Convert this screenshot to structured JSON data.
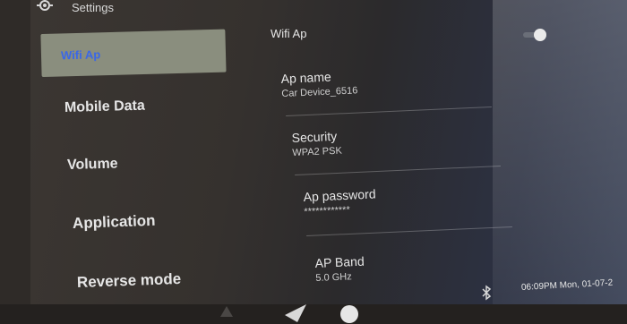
{
  "header": {
    "title": "Settings",
    "icon": "gear-icon"
  },
  "sidebar": {
    "items": [
      {
        "label": "Wifi Ap",
        "active": true
      },
      {
        "label": "Mobile Data"
      },
      {
        "label": "Volume"
      },
      {
        "label": "Application"
      },
      {
        "label": "Reverse mode"
      }
    ]
  },
  "main": {
    "title": "Wifi Ap",
    "toggle_on": true,
    "prefs": [
      {
        "label": "Ap name",
        "value": "Car Device_6516"
      },
      {
        "label": "Security",
        "value": "WPA2 PSK"
      },
      {
        "label": "Ap password",
        "value": "************"
      },
      {
        "label": "AP Band",
        "value": "5.0 GHz"
      }
    ]
  },
  "statusbar": {
    "time": "06:09PM Mon, 01-07-2",
    "icons": [
      "bluetooth-icon"
    ]
  },
  "colors": {
    "active_item_bg": "#8a8e7e",
    "active_item_text": "#3a67e8"
  }
}
